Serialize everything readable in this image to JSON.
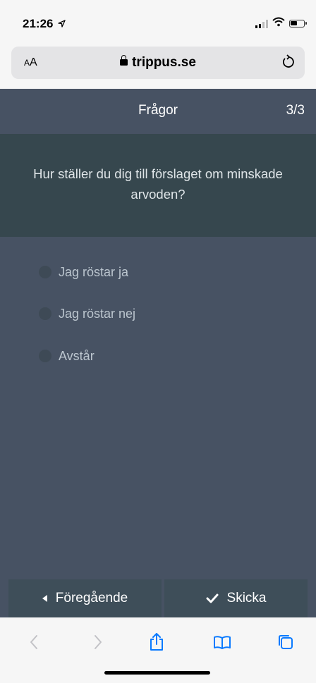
{
  "status": {
    "time": "21:26",
    "location_glyph": "⇗"
  },
  "browser": {
    "aa_label_small": "A",
    "aa_label_large": "A",
    "url": "trippus.se"
  },
  "header": {
    "title": "Frågor",
    "counter": "3/3"
  },
  "question": {
    "text": "Hur ställer du dig till förslaget om minskade arvoden?"
  },
  "options": [
    {
      "label": "Jag röstar ja",
      "selected": false
    },
    {
      "label": "Jag röstar nej",
      "selected": false
    },
    {
      "label": "Avstår",
      "selected": false
    }
  ],
  "footer": {
    "prev_label": "Föregående",
    "submit_label": "Skicka"
  },
  "toolbar": {
    "icons": [
      "back-icon",
      "forward-icon",
      "share-icon",
      "bookmarks-icon",
      "tabs-icon"
    ]
  },
  "colors": {
    "header_bg": "#475263",
    "question_bg": "#36474e",
    "button_bg": "#3e4e59",
    "ios_blue": "#0a7aff"
  }
}
